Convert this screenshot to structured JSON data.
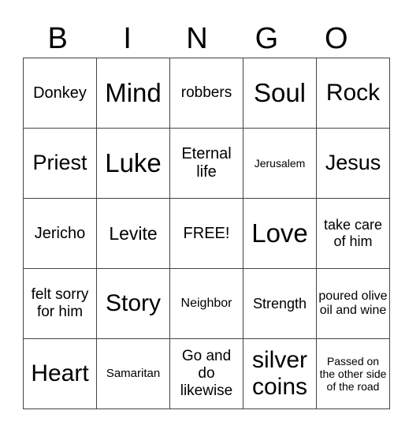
{
  "header": [
    "B",
    "I",
    "N",
    "G",
    "O"
  ],
  "rows": [
    [
      "Donkey",
      "Mind",
      "robbers",
      "Soul",
      "Rock"
    ],
    [
      "Priest",
      "Luke",
      "Eternal life",
      "Jerusalem",
      "Jesus"
    ],
    [
      "Jericho",
      "Levite",
      "FREE!",
      "Love",
      "take care of him"
    ],
    [
      "felt sorry for him",
      "Story",
      "Neighbor",
      "Strength",
      "poured olive oil and wine"
    ],
    [
      "Heart",
      "Samaritan",
      "Go and do likewise",
      "silver coins",
      "Passed on the other side of the road"
    ]
  ]
}
